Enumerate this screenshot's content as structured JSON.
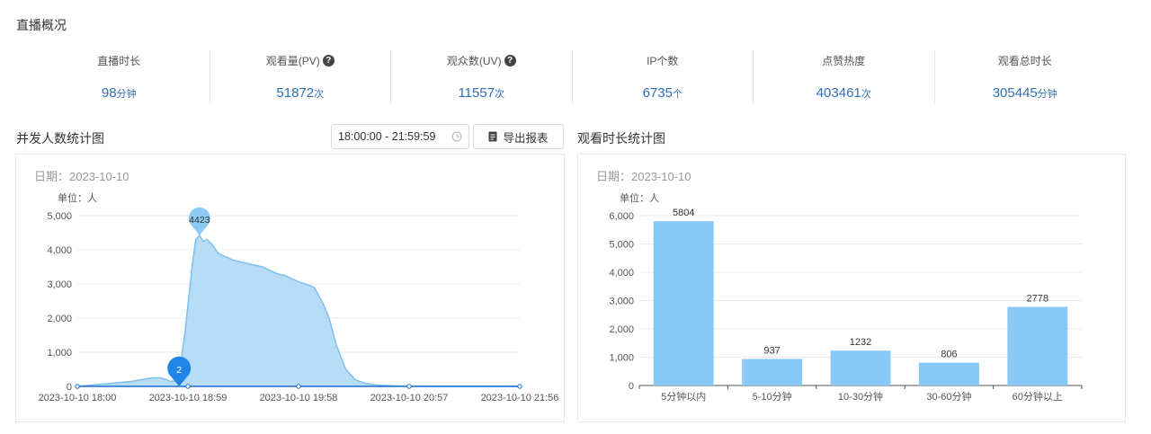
{
  "section_title": "直播概况",
  "stats": [
    {
      "label": "直播时长",
      "value": "98",
      "unit": "分钟",
      "help": false
    },
    {
      "label": "观看量(PV)",
      "value": "51872",
      "unit": "次",
      "help": true
    },
    {
      "label": "观众数(UV)",
      "value": "11557",
      "unit": "次",
      "help": true
    },
    {
      "label": "IP个数",
      "value": "6735",
      "unit": "个",
      "help": false
    },
    {
      "label": "点赞热度",
      "value": "403461",
      "unit": "次",
      "help": false
    },
    {
      "label": "观看总时长",
      "value": "305445",
      "unit": "分钟",
      "help": false
    }
  ],
  "concurrency": {
    "title": "并发人数统计图",
    "time_range": "18:00:00 - 21:59:59",
    "export_label": "导出报表"
  },
  "duration": {
    "title": "观看时长统计图"
  },
  "colors": {
    "accent_blue": "#2f6fb7",
    "area_fill": "#a9d6f5",
    "area_line": "#7ec0ee",
    "bar_fill": "#88c9f8",
    "marker_dark": "#1f86e8",
    "marker_light": "#8ccaf6"
  },
  "chart_data": [
    {
      "type": "area",
      "date_label": "日期：2023-10-10",
      "unit_label": "单位：人",
      "x_ticks": [
        "2023-10-10 18:00",
        "2023-10-10 18:59",
        "2023-10-10 19:58",
        "2023-10-10 20:57",
        "2023-10-10 21:56"
      ],
      "ylim": [
        0,
        5000
      ],
      "y_ticks": [
        0,
        1000,
        2000,
        3000,
        4000,
        5000
      ],
      "y_tick_labels": [
        "0",
        "1,000",
        "2,000",
        "3,000",
        "4,000",
        "5,000"
      ],
      "x_minutes": [
        0,
        10,
        20,
        30,
        35,
        40,
        45,
        48,
        50,
        53,
        55,
        58,
        60,
        62,
        64,
        66,
        68,
        70,
        73,
        76,
        80,
        84,
        88,
        92,
        96,
        100,
        104,
        108,
        112,
        116,
        120,
        123,
        126,
        128,
        130,
        133,
        136,
        140,
        145,
        150,
        155,
        160,
        165,
        170,
        175,
        180,
        190,
        200,
        210,
        220,
        230,
        239
      ],
      "values": [
        0,
        50,
        100,
        150,
        200,
        250,
        250,
        200,
        150,
        150,
        400,
        1500,
        2500,
        3500,
        4300,
        4423,
        4250,
        4300,
        4150,
        3900,
        3800,
        3700,
        3650,
        3600,
        3550,
        3500,
        3400,
        3300,
        3250,
        3150,
        3050,
        3000,
        2950,
        2900,
        2700,
        2400,
        2000,
        1200,
        500,
        200,
        100,
        50,
        30,
        20,
        10,
        5,
        0,
        0,
        0,
        0,
        0,
        0
      ],
      "max": {
        "value": 4423,
        "label": "4423"
      },
      "min": {
        "value": 2,
        "label": "2"
      }
    },
    {
      "type": "bar",
      "date_label": "日期：2023-10-10",
      "unit_label": "单位：人",
      "categories": [
        "5分钟以内",
        "5-10分钟",
        "10-30分钟",
        "30-60分钟",
        "60分钟以上"
      ],
      "values": [
        5804,
        937,
        1232,
        806,
        2778
      ],
      "value_labels": [
        "5804",
        "937",
        "1232",
        "806",
        "2778"
      ],
      "ylim": [
        0,
        6000
      ],
      "y_ticks": [
        0,
        1000,
        2000,
        3000,
        4000,
        5000,
        6000
      ],
      "y_tick_labels": [
        "0",
        "1,000",
        "2,000",
        "3,000",
        "4,000",
        "5,000",
        "6,000"
      ]
    }
  ]
}
